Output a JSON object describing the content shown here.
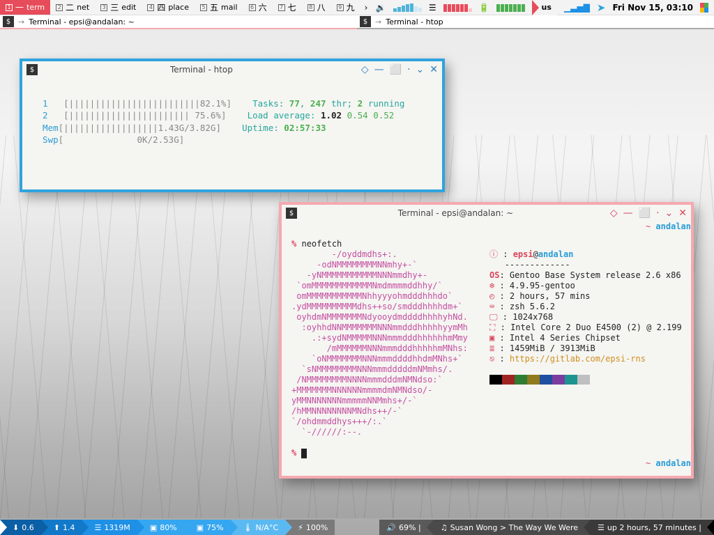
{
  "topbar": {
    "workspaces": [
      {
        "num": "1",
        "cn": "一",
        "label": "term",
        "active": true
      },
      {
        "num": "2",
        "cn": "二",
        "label": "net"
      },
      {
        "num": "3",
        "cn": "三",
        "label": "edit"
      },
      {
        "num": "4",
        "cn": "四",
        "label": "place"
      },
      {
        "num": "5",
        "cn": "五",
        "label": "mail"
      },
      {
        "num": "6",
        "cn": "六",
        "label": ""
      },
      {
        "num": "7",
        "cn": "七",
        "label": ""
      },
      {
        "num": "8",
        "cn": "八",
        "label": ""
      },
      {
        "num": "9",
        "cn": "九",
        "label": ""
      }
    ],
    "layout_tag": "us",
    "clock": "Fri Nov 15, 03:10"
  },
  "tasks": {
    "left": "Terminal - epsi@andalan: ~",
    "right": "Terminal - htop"
  },
  "htop_window": {
    "title": "Terminal - htop",
    "cpu1": {
      "label": "1",
      "bar": "[|||||||||||||||||||||||||",
      "pct": "82.1%",
      "end": "]"
    },
    "cpu2": {
      "label": "2",
      "bar": "[||||||||||||||||||||||| ",
      "pct": "75.6%",
      "end": "]"
    },
    "mem": {
      "label": "Mem",
      "bar": "[||||||||||||||||||",
      "val": "1.43G/3.82G",
      "end": "]"
    },
    "swp": {
      "label": "Swp",
      "bar": "[",
      "val": "0K/2.53G",
      "end": "]"
    },
    "tasks_lbl": "Tasks: ",
    "tasks_a": "77",
    "tasks_sep": ", ",
    "tasks_b": "247",
    "tasks_thr": " thr; ",
    "tasks_c": "2",
    "tasks_run": " running",
    "load_lbl": "Load average: ",
    "load_a": "1.02",
    "load_b": "0.54",
    "load_c": "0.52",
    "uptime_lbl": "Uptime: ",
    "uptime_val": "02:57:33"
  },
  "neofetch_window": {
    "title": "Terminal - epsi@andalan: ~",
    "prompt_sym": "%",
    "prompt_cmd": "neofetch",
    "host_right": "~ ",
    "host_name": "andalan",
    "ascii": [
      "        -/oyddmdhs+:.",
      "     -odNMMMMMMMMNNmhy+-`",
      "   -yNMMMMMMMMMMMNNNmmdhy+-",
      " `omMMMMMMMMMMMMNmdmmmmddhhy/`",
      " omMMMMMMMMMMMNhhyyyohmdddhhhdo`",
      ".ydMMMMMMMMMMdhs++so/smdddhhhhdm+`",
      " oyhdmNMMMMMMMNdyooydmddddhhhhyhNd.",
      "  :oyhhdNNMMMMMMMNNNmmdddhhhhhyymMh",
      "    .:+sydNMMMMMNNNmmmdddhhhhhhmMmy",
      "       /mMMMMMMNNNmmmdddhhhhhmMNhs:",
      "    `oNMMMMMMMNNNmmmddddhhdmMNhs+`",
      "  `sNMMMMMMMMNNNmmmdddddmNMmhs/.",
      " /NMMMMMMMMNNNNmmmdddmNMNdso:`",
      "+MMMMMMMNNNNNNmmmmdmNMNdso/-",
      "yMMNNNNNNNmmmmmNNMmhs+/-`",
      "/hMMNNNNNNNNMNdhs++/-`",
      "`/ohdmmddhys+++/:.`",
      "  `-//////:--."
    ],
    "info": {
      "user": "epsi",
      "at": "@",
      "host": "andalan",
      "sep": "-------------",
      "os_lbl": "OS",
      "os": "Gentoo Base System release 2.6 x86",
      "kernel_lbl": "",
      "kernel": "4.9.95-gentoo",
      "uptime_lbl": "",
      "uptime": "2 hours, 57 mins",
      "shell_lbl": "",
      "shell": "zsh 5.6.2",
      "res_lbl": "",
      "res": "1024x768",
      "cpu_lbl": "",
      "cpu": "Intel Core 2 Duo E4500 (2) @ 2.199",
      "gpu_lbl": "",
      "gpu": "Intel 4 Series Chipset",
      "mem_lbl": "",
      "mem": "1459MiB / 3913MiB",
      "link_lbl": "",
      "link": "https://gitlab.com/epsi-rns"
    },
    "swatches": [
      "#000",
      "#a02424",
      "#2e7d32",
      "#8f7a1e",
      "#1e4fa0",
      "#7b3ca0",
      "#1e9490",
      "#bfbfbf"
    ]
  },
  "bottombar": {
    "left": [
      {
        "icon": "⬇",
        "val": "0.6"
      },
      {
        "icon": "⬆",
        "val": "1.4"
      },
      {
        "icon": "☰",
        "val": "1319M"
      },
      {
        "icon": "▣",
        "val": "80%"
      },
      {
        "icon": "▣",
        "val": "75%"
      },
      {
        "icon": "🌡",
        "val": "N/A°C"
      },
      {
        "icon": "⚡",
        "val": "100%"
      }
    ],
    "right": [
      {
        "icon": "🔊",
        "val": "69% |"
      },
      {
        "icon": "♫",
        "val": "Susan Wong > The Way We Were"
      },
      {
        "icon": "☰",
        "val": "up 2 hours, 57 minutes |"
      }
    ]
  }
}
